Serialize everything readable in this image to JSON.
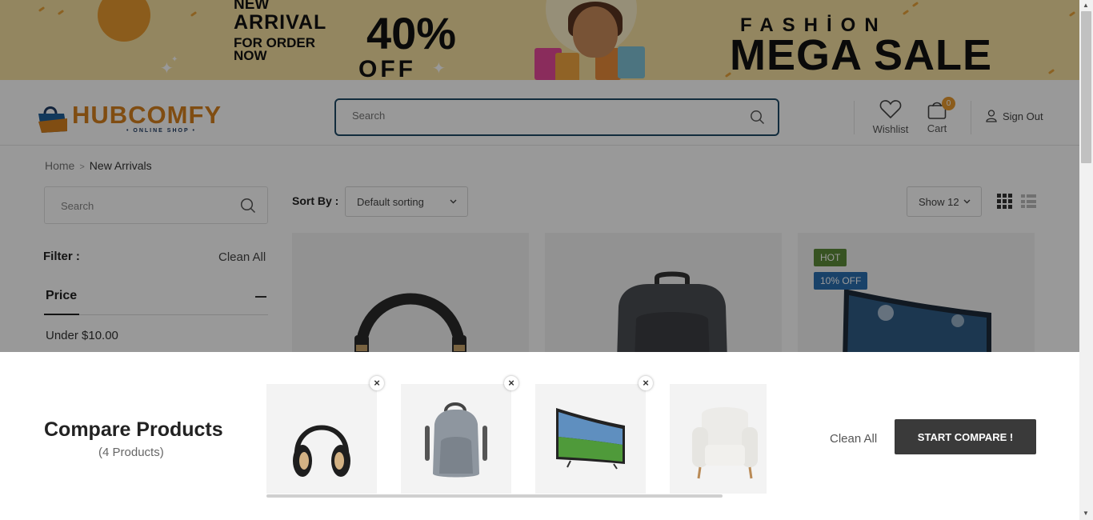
{
  "banner": {
    "new": "NEW",
    "arrival": "ARRIVAL",
    "for_order": "FOR ORDER",
    "now": "NOW",
    "percent": "40%",
    "off": "OFF",
    "fashion": "FASHİON",
    "mega_sale": "MEGA SALE"
  },
  "header": {
    "logo_text": "HUBCOMFY",
    "logo_sub": "• ONLINE SHOP •",
    "search_placeholder": "Search",
    "wishlist_label": "Wishlist",
    "cart_label": "Cart",
    "cart_count": "0",
    "signout_label": "Sign Out"
  },
  "breadcrumb": {
    "home": "Home",
    "current": "New Arrivals"
  },
  "sidebar": {
    "search_placeholder": "Search",
    "filter_label": "Filter :",
    "clean_all": "Clean All",
    "price_heading": "Price",
    "price_option": "Under $10.00"
  },
  "toolbar": {
    "sort_label": "Sort By :",
    "sort_value": "Default sorting",
    "show_value": "Show 12"
  },
  "products": [
    {
      "name": "headphones"
    },
    {
      "name": "backpack"
    },
    {
      "name": "curved-tv",
      "badges": [
        "HOT",
        "10% OFF"
      ]
    }
  ],
  "compare": {
    "title": "Compare Products",
    "count": "(4 Products)",
    "items": [
      "headphones",
      "backpack",
      "curved-tv",
      "armchair"
    ],
    "remove_symbol": "×",
    "clean_all": "Clean All",
    "start_button": "START COMPARE !"
  },
  "colors": {
    "accent": "#e89a2f",
    "search_border": "#1e4a66",
    "hot_badge": "#5d8a3a",
    "off_badge": "#2a6fb0",
    "button_dark": "#3a3a3a"
  }
}
